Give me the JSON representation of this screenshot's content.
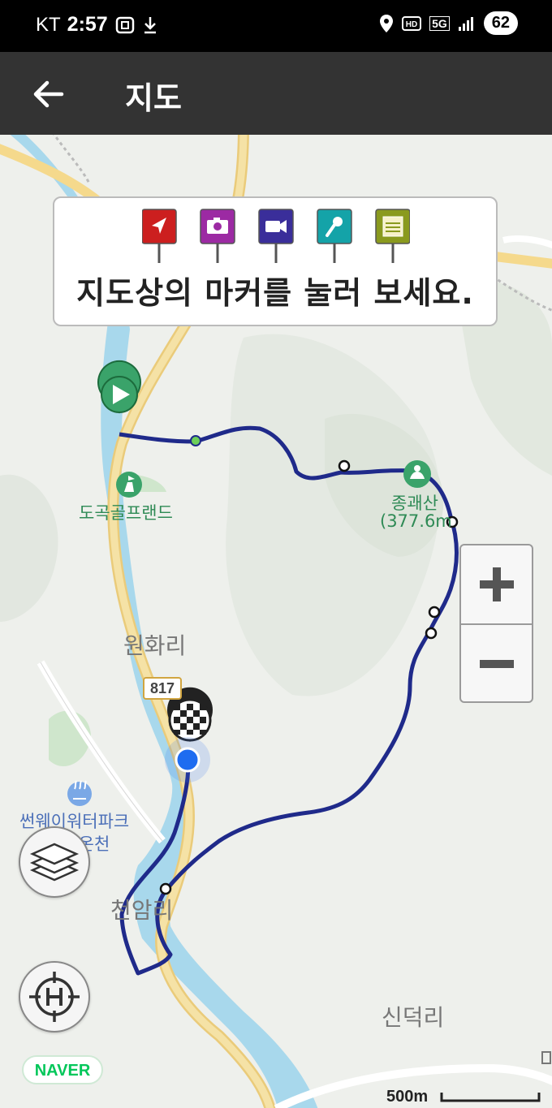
{
  "status_bar": {
    "carrier": "KT",
    "time": "2:57",
    "network": "5G",
    "battery": "62"
  },
  "header": {
    "title": "지도"
  },
  "tooltip": {
    "message": "지도상의 마커를 눌러 보세요.",
    "markers": [
      {
        "name": "navigation-marker-icon",
        "color": "#cc1f1f"
      },
      {
        "name": "camera-marker-icon",
        "color": "#9c2aa3"
      },
      {
        "name": "video-marker-icon",
        "color": "#3a2e9a"
      },
      {
        "name": "microphone-marker-icon",
        "color": "#14a3a8"
      },
      {
        "name": "memo-marker-icon",
        "color": "#8a9a1e"
      }
    ]
  },
  "map": {
    "labels": {
      "golf": "도곡골프랜드",
      "peak_name": "종괘산",
      "peak_height": "(377.6m",
      "village_1": "원화리",
      "waterpark": "썬웨이워터파크",
      "hotspring": "도곡온천",
      "village_2": "천암리",
      "village_3": "신덕리"
    },
    "road_number": "817",
    "scale_label": "500m",
    "route_color": "#1f2a8a",
    "water_color": "#a8d8ec",
    "road_color": "#f5d98c"
  },
  "controls": {
    "zoom_in": "+",
    "zoom_out": "−"
  },
  "branding": {
    "naver": "NAVER"
  }
}
